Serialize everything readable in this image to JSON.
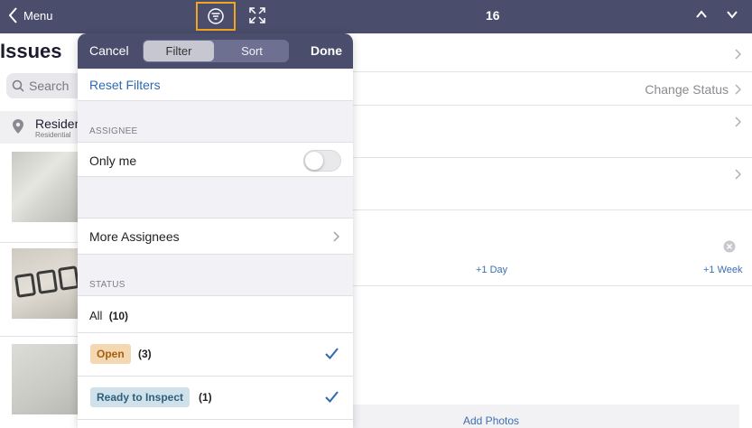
{
  "topbar": {
    "menu_label": "Menu",
    "page_number": "16",
    "bg_color": "#4a4d6b",
    "highlight_color": "#f2a51e",
    "icons": [
      "chevron-left-icon",
      "filter-icon",
      "expand-icon",
      "chevron-up-icon",
      "chevron-down-icon"
    ]
  },
  "issues_panel": {
    "title": "Issues",
    "search_placeholder": "Search",
    "location": {
      "name": "Residen",
      "sub": "Residential"
    }
  },
  "detail_panel": {
    "change_status": "Change Status",
    "plus_day": "+1 Day",
    "plus_week": "+1 Week",
    "add_photos": "Add Photos"
  },
  "filter_popover": {
    "cancel": "Cancel",
    "done": "Done",
    "tabs": [
      {
        "label": "Filter",
        "selected": true
      },
      {
        "label": "Sort",
        "selected": false
      }
    ],
    "reset_filters": "Reset Filters",
    "assignee_header": "ASSIGNEE",
    "only_me": {
      "label": "Only me",
      "on": false
    },
    "more_assignees": "More Assignees",
    "status_header": "STATUS",
    "status_all": {
      "label": "All",
      "count": "(10)"
    },
    "status_items": [
      {
        "label": "Open",
        "count": "(3)",
        "checked": true,
        "color": "#f3d8b2"
      },
      {
        "label": "Ready to Inspect",
        "count": "(1)",
        "checked": true,
        "color": "#cfe1ea"
      }
    ],
    "accent_color": "#2d6bb0"
  }
}
